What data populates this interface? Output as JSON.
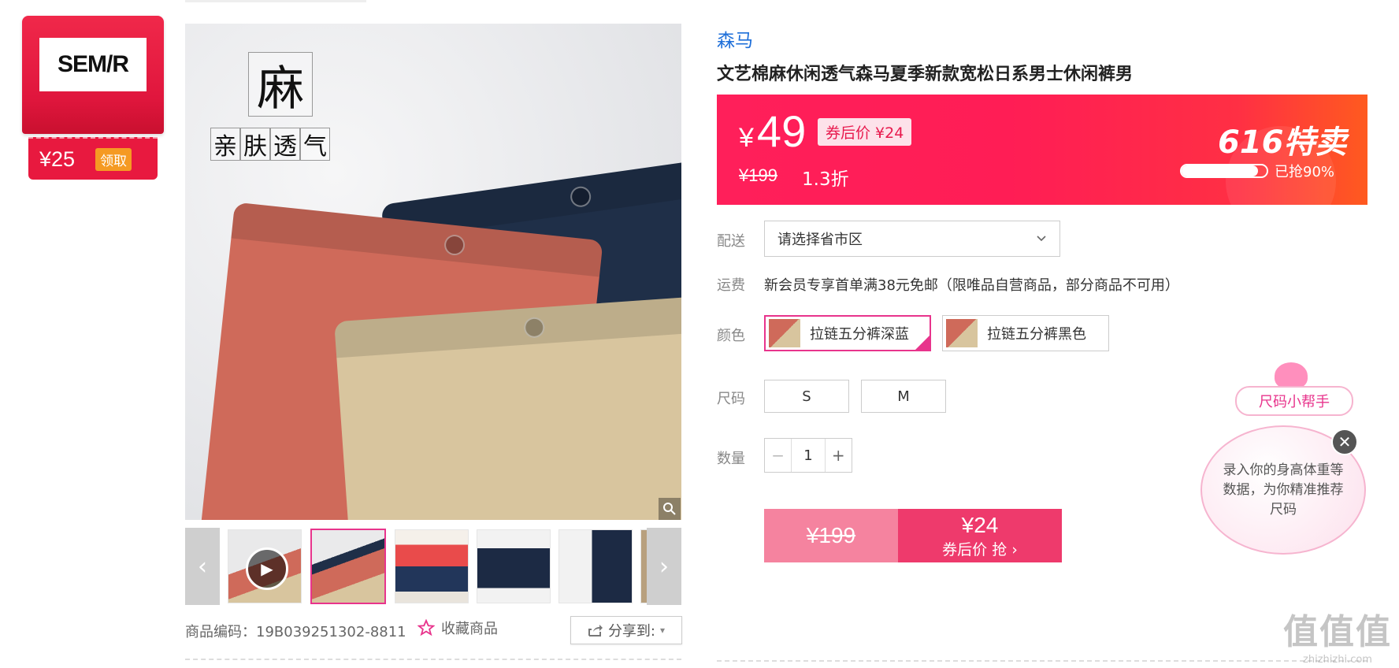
{
  "coupon": {
    "logo": "SEM/R",
    "price": "¥25",
    "claim_label": "领取"
  },
  "image": {
    "char_big": "麻",
    "tagline_chars": [
      "亲",
      "肤",
      "透",
      "气"
    ],
    "zoom_icon": "magnifier-icon"
  },
  "thumbnails": {
    "prev_icon": "chevron-left-icon",
    "next_icon": "chevron-right-icon"
  },
  "footer": {
    "code_label": "商品编码：19B039251302-8811",
    "favorite_label": "收藏商品",
    "share_label": "分享到:",
    "share_caret": "▾"
  },
  "product": {
    "brand": "森马",
    "title": "文艺棉麻休闲透气森马夏季新款宽松日系男士休闲裤男"
  },
  "price_banner": {
    "currency": "¥",
    "price": "49",
    "coupon_price": "券后价 ¥24",
    "original_price": "¥199",
    "discount": "1.3折",
    "event": "616特卖",
    "sold_label": "已抢90%",
    "sold_fraction": 0.9
  },
  "delivery": {
    "label": "配送",
    "placeholder": "请选择省市区"
  },
  "shipping": {
    "label": "运费",
    "text": "新会员专享首单满38元免邮（限唯品自营商品，部分商品不可用）"
  },
  "color": {
    "label": "颜色",
    "options": [
      "拉链五分裤深蓝",
      "拉链五分裤黑色"
    ]
  },
  "size": {
    "label": "尺码",
    "options": [
      "S",
      "M"
    ]
  },
  "quantity": {
    "label": "数量",
    "value": "1",
    "minus": "−",
    "plus": "+"
  },
  "buy": {
    "original_price": "¥199",
    "coupon_price": "¥24",
    "action": "券后价 抢 ›"
  },
  "size_helper": {
    "button": "尺码小帮手",
    "bubble_text": "录入你的身高体重等数据，为你精准推荐尺码",
    "close": "✕"
  },
  "watermark": {
    "big": "值值值",
    "small": "zhizhizhi.com"
  },
  "colors": {
    "accent": "#e8348c",
    "banner": "#ff1f5a",
    "brand_link": "#1e6fd9"
  }
}
